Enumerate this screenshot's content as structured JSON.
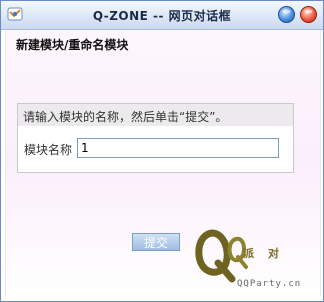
{
  "window": {
    "title": "Q-ZONE -- 网页对话框",
    "icons": {
      "app": "qzone-app-icon",
      "minimize": "minimize-icon",
      "close": "close-icon"
    }
  },
  "dialog": {
    "heading": "新建模块/重命名模块",
    "hint": "请输入模块的名称，然后单击“提交”。",
    "field_label": "模块名称",
    "field_value": "1",
    "submit_label": "提交"
  },
  "brand": {
    "logo_letters": "QQ",
    "name": "派对",
    "url": "QQParty.cn"
  }
}
